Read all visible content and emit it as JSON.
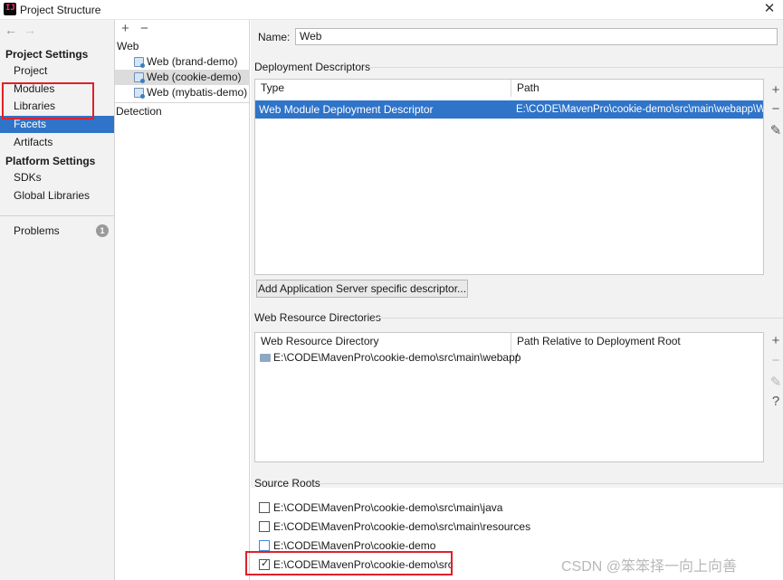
{
  "window": {
    "title": "Project Structure"
  },
  "nav": {
    "back": "←",
    "forward": "→",
    "project_settings_header": "Project Settings",
    "project_settings_items": [
      "Project",
      "Modules",
      "Libraries",
      "Facets",
      "Artifacts"
    ],
    "platform_settings_header": "Platform Settings",
    "platform_settings_items": [
      "SDKs",
      "Global Libraries"
    ],
    "problems_label": "Problems",
    "problems_count": "1"
  },
  "facets_tree": {
    "add": "+",
    "remove": "−",
    "root": "Web",
    "items": [
      "Web (brand-demo)",
      "Web (cookie-demo)",
      "Web (mybatis-demo)"
    ],
    "detection": "Detection"
  },
  "detail": {
    "name_label": "Name:",
    "name_value": "Web",
    "deployment_descriptors": {
      "title": "Deployment Descriptors",
      "columns": [
        "Type",
        "Path"
      ],
      "rows": [
        {
          "type": "Web Module Deployment Descriptor",
          "path": "E:\\CODE\\MavenPro\\cookie-demo\\src\\main\\webapp\\WEB"
        }
      ],
      "add_server_descriptor": "Add Application Server specific descriptor..."
    },
    "web_resource_directories": {
      "title": "Web Resource Directories",
      "columns": [
        "Web Resource Directory",
        "Path Relative to Deployment Root"
      ],
      "rows": [
        {
          "directory": "E:\\CODE\\MavenPro\\cookie-demo\\src\\main\\webapp",
          "relative": "/"
        }
      ]
    },
    "source_roots": {
      "title": "Source Roots",
      "items": [
        {
          "path": "E:\\CODE\\MavenPro\\cookie-demo\\src\\main\\java",
          "checked": false
        },
        {
          "path": "E:\\CODE\\MavenPro\\cookie-demo\\src\\main\\resources",
          "checked": false
        },
        {
          "path": "E:\\CODE\\MavenPro\\cookie-demo",
          "checked": false
        },
        {
          "path": "E:\\CODE\\MavenPro\\cookie-demo\\src",
          "checked": true
        }
      ]
    }
  },
  "icons": {
    "add": "+",
    "remove": "−",
    "edit": "✎",
    "help": "?",
    "close": "✕",
    "check": "✓"
  },
  "colors": {
    "selection": "#2f74c9",
    "highlight_box": "#e0202a"
  },
  "watermark": "CSDN @笨笨择一向上向善"
}
